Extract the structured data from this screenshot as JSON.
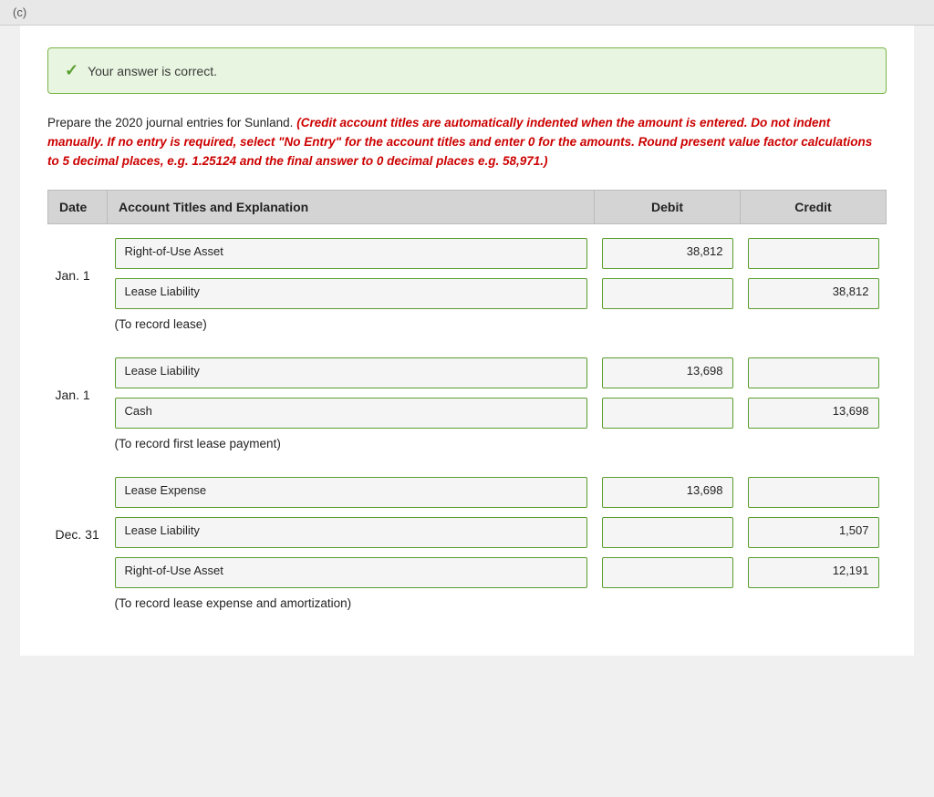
{
  "topbar": {
    "label": "(c)"
  },
  "banner": {
    "text": "Your answer is correct."
  },
  "instruction": {
    "prefix": "Prepare the 2020 journal entries for Sunland.",
    "red_text": "(Credit account titles are automatically indented when the amount is entered. Do not indent manually. If no entry is required, select \"No Entry\" for the account titles and enter 0 for the amounts. Round present value factor calculations to 5 decimal places, e.g. 1.25124 and the final answer to 0 decimal places e.g. 58,971.)"
  },
  "table": {
    "headers": {
      "date": "Date",
      "account": "Account Titles and Explanation",
      "debit": "Debit",
      "credit": "Credit"
    },
    "entries": [
      {
        "id": "entry1",
        "date": "Jan. 1",
        "rows": [
          {
            "account": "Right-of-Use Asset",
            "debit": "38,812",
            "credit": ""
          },
          {
            "account": "Lease Liability",
            "debit": "",
            "credit": "38,812"
          }
        ],
        "note": "(To record lease)"
      },
      {
        "id": "entry2",
        "date": "Jan.  1",
        "rows": [
          {
            "account": "Lease Liability",
            "debit": "13,698",
            "credit": ""
          },
          {
            "account": "Cash",
            "debit": "",
            "credit": "13,698"
          }
        ],
        "note": "(To record first lease payment)"
      },
      {
        "id": "entry3",
        "date": "Dec. 31",
        "rows": [
          {
            "account": "Lease Expense",
            "debit": "13,698",
            "credit": ""
          },
          {
            "account": "Lease Liability",
            "debit": "",
            "credit": "1,507"
          },
          {
            "account": "Right-of-Use Asset",
            "debit": "",
            "credit": "12,191"
          }
        ],
        "note": "(To record lease expense and amortization)"
      }
    ]
  }
}
